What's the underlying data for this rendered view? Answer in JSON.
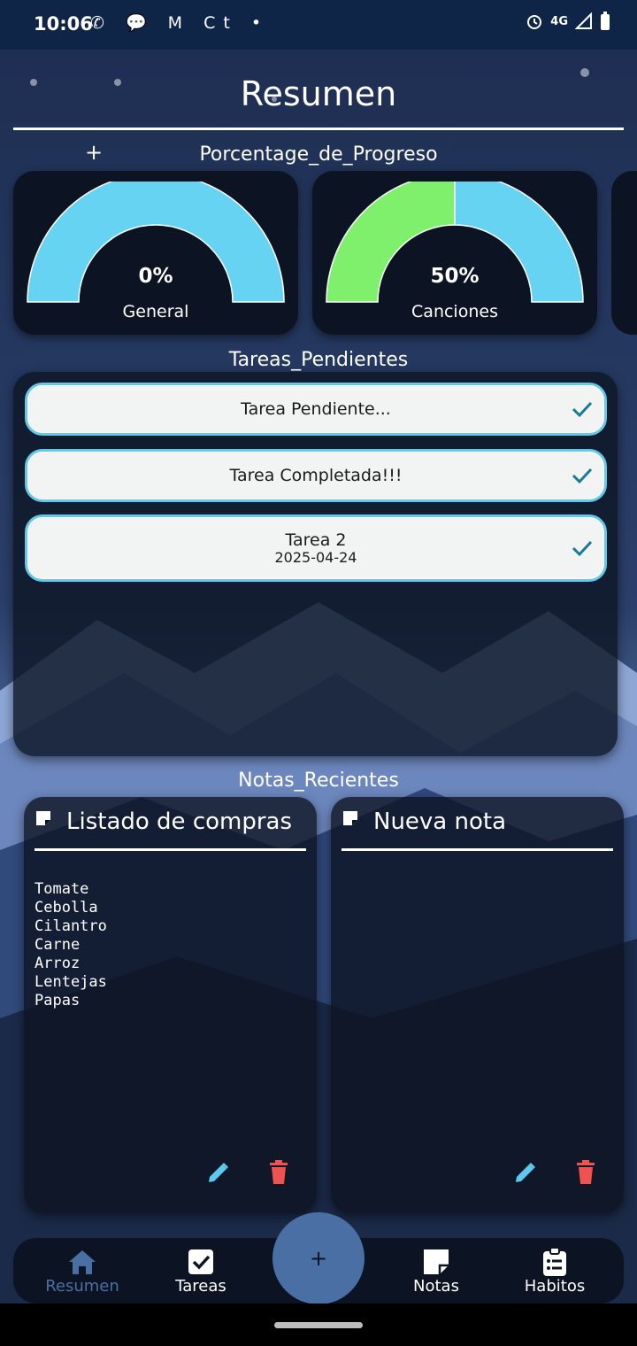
{
  "status_bar": {
    "time": "10:06",
    "app_icons": "✆ 💬 M Ct •",
    "network": "4G"
  },
  "header": {
    "title": "Resumen"
  },
  "progress_section": {
    "title": "Porcentage_de_Progreso",
    "add_symbol": "+",
    "gauges": [
      {
        "value_text": "0%",
        "label": "General",
        "fraction": 0.0
      },
      {
        "value_text": "50%",
        "label": "Canciones",
        "fraction": 0.5
      }
    ],
    "colors": {
      "track": "#66d3f2",
      "fill": "#7ef06b"
    }
  },
  "tasks_section": {
    "title": "Tareas_Pendientes",
    "tasks": [
      {
        "title": "Tarea Pendiente...",
        "date": ""
      },
      {
        "title": "Tarea Completada!!!",
        "date": ""
      },
      {
        "title": "Tarea 2",
        "date": "2025-04-24"
      }
    ]
  },
  "notes_section": {
    "title": "Notas_Recientes",
    "notes": [
      {
        "title": "Listado de compras",
        "body": "Tomate\nCebolla\nCilantro\nCarne\nArroz\nLentejas\nPapas"
      },
      {
        "title": "Nueva nota",
        "body": ""
      }
    ]
  },
  "bottom_nav": {
    "items": [
      {
        "label": "Resumen",
        "icon": "home-icon",
        "active": true
      },
      {
        "label": "Tareas",
        "icon": "checkbox-icon",
        "active": false
      },
      {
        "label": "Notas",
        "icon": "note-icon",
        "active": false
      },
      {
        "label": "Habitos",
        "icon": "clipboard-list-icon",
        "active": false
      }
    ],
    "fab_symbol": "+"
  }
}
